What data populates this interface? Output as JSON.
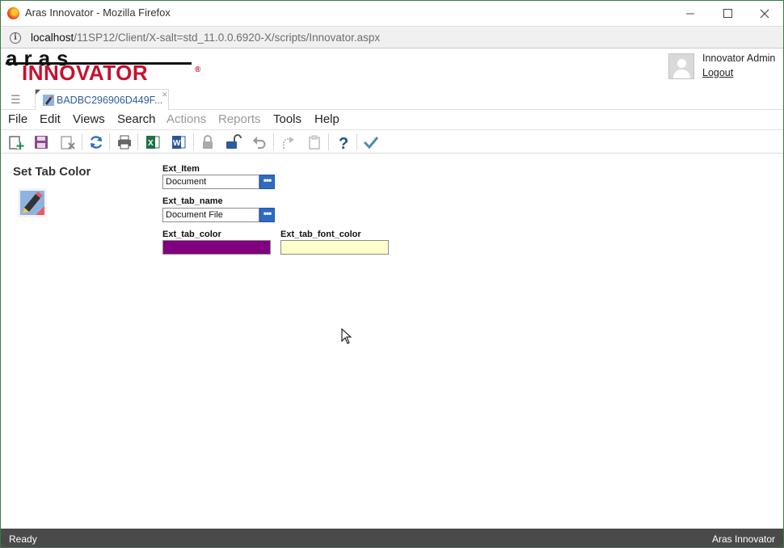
{
  "window": {
    "title": "Aras Innovator - Mozilla Firefox",
    "url_host": "localhost",
    "url_path": "/11SP12/Client/X-salt=std_11.0.0.6920-X/scripts/Innovator.aspx"
  },
  "header": {
    "logo_top": "aras",
    "logo_main": "INNOVATOR",
    "logo_reg": "®",
    "user_name": "Innovator Admin",
    "logout_label": "Logout"
  },
  "tabs": [
    {
      "label": "BADBC296906D449F...",
      "icon": "document-icon"
    }
  ],
  "menu": {
    "items": [
      {
        "label": "File",
        "enabled": true
      },
      {
        "label": "Edit",
        "enabled": true
      },
      {
        "label": "Views",
        "enabled": true
      },
      {
        "label": "Search",
        "enabled": true
      },
      {
        "label": "Actions",
        "enabled": false
      },
      {
        "label": "Reports",
        "enabled": false
      },
      {
        "label": "Tools",
        "enabled": true
      },
      {
        "label": "Help",
        "enabled": true
      }
    ]
  },
  "toolbar": {
    "icons": [
      "new-item-icon",
      "save-icon",
      "delete-icon",
      "refresh-icon",
      "print-icon",
      "excel-export-icon",
      "word-export-icon",
      "lock-icon",
      "unlock-icon",
      "undo-icon",
      "redo-icon",
      "clipboard-icon",
      "help-icon",
      "done-icon"
    ]
  },
  "form": {
    "title": "Set Tab Color",
    "fields": {
      "ext_item": {
        "label": "Ext_Item",
        "value": "Document"
      },
      "ext_tab_name": {
        "label": "Ext_tab_name",
        "value": "Document File"
      },
      "ext_tab_color": {
        "label": "Ext_tab_color",
        "color": "#800080"
      },
      "ext_tab_font_color": {
        "label": "Ext_tab_font_color",
        "color": "#ffffcc"
      }
    },
    "ellipsis": "•••"
  },
  "status": {
    "left": "Ready",
    "right": "Aras Innovator"
  },
  "colors": {
    "brand_red": "#c8102e",
    "accent_blue": "#2d6bc4",
    "statusbar": "#4a4a4a"
  }
}
